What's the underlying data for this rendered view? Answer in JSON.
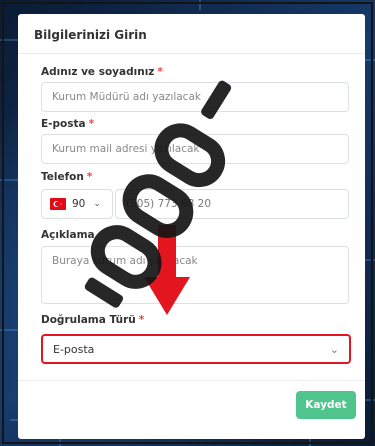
{
  "panel": {
    "title": "Bilgilerinizi Girin"
  },
  "fields": {
    "name": {
      "label": "Adınız ve soyadınız",
      "required": "*",
      "placeholder": "Kurum Müdürü adı yazılacak"
    },
    "email": {
      "label": "E-posta",
      "required": "*",
      "placeholder": "Kurum mail adresi yazılacak"
    },
    "phone": {
      "label": "Telefon",
      "required": "*",
      "country_code": "90",
      "value": "(505) 773 68 20"
    },
    "description": {
      "label": "Açıklama",
      "placeholder": "Buraya kurum adı yazılacak"
    },
    "verification": {
      "label": "Doğrulama Türü",
      "required": "*",
      "selected": "E-posta"
    }
  },
  "actions": {
    "save_label": "Kaydet"
  },
  "colors": {
    "accent_save": "#4fc48c",
    "highlight": "#e3161f",
    "required": "#e44"
  },
  "icons": {
    "flag": "turkey-flag-icon",
    "dropdown": "chevron-down-icon",
    "annotation": "red-arrow-icon"
  }
}
